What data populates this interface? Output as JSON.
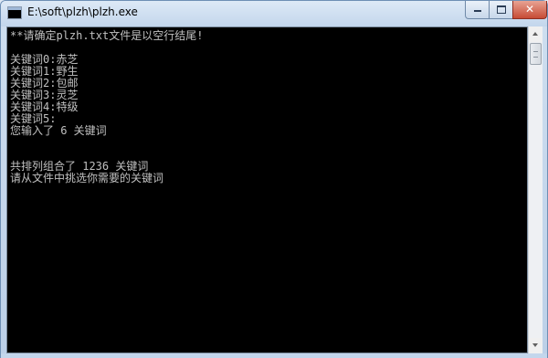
{
  "window": {
    "title": "E:\\soft\\plzh\\plzh.exe"
  },
  "controls": {
    "minimize_icon": "minimize-icon",
    "maximize_icon": "maximize-icon",
    "close_icon": "close-icon",
    "close_glyph": "✕"
  },
  "console": {
    "lines": [
      "**请确定plzh.txt文件是以空行结尾!",
      "",
      "关键词0:赤芝",
      "关键词1:野生",
      "关键词2:包邮",
      "关键词3:灵芝",
      "关键词4:特级",
      "关键词5:",
      "您输入了 6 关键词",
      "",
      "",
      "共排列组合了 1236 关键词",
      "请从文件中挑选你需要的关键词"
    ]
  },
  "colors": {
    "console_bg": "#000000",
    "console_text": "#c0c0c0",
    "close_button": "#c74b35"
  }
}
